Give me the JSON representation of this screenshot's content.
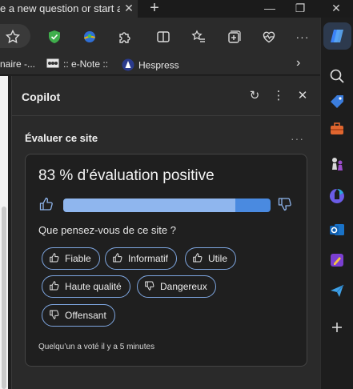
{
  "browser": {
    "tab_title": "e a new question or start a c",
    "tab_close": "✕",
    "new_tab": "+",
    "window_minimize": "—",
    "window_restore": "❐",
    "window_close": "✕"
  },
  "toolbar": {
    "icons": [
      "favorite-star-icon",
      "adguard-shield-icon",
      "extension-globe-icon",
      "extensions-puzzle-icon",
      "split-screen-icon",
      "favorites-list-icon",
      "collections-icon",
      "browser-essentials-heart-icon",
      "more-dots-icon",
      "copilot-icon"
    ],
    "more_label": "···"
  },
  "bookmarks": {
    "items": [
      {
        "label": "naire -..."
      },
      {
        "label": ":: e-Note ::"
      },
      {
        "label": "Hespress"
      }
    ],
    "overflow": "›"
  },
  "copilot": {
    "title": "Copilot",
    "refresh": "↻",
    "more": "⋮",
    "close": "✕",
    "section_title": "Évaluer ce site",
    "section_more": "···",
    "rating": {
      "headline": "83 % d’évaluation positive",
      "positive_fraction": 0.83,
      "question": "Que pensez-vous de ce site ?",
      "chips": [
        {
          "label": "Fiable",
          "kind": "up"
        },
        {
          "label": "Informatif",
          "kind": "up"
        },
        {
          "label": "Utile",
          "kind": "up"
        },
        {
          "label": "Haute qualité",
          "kind": "up"
        },
        {
          "label": "Dangereux",
          "kind": "down"
        },
        {
          "label": "Offensant",
          "kind": "down"
        }
      ],
      "voted": "Quelqu’un a voté il y a 5 minutes"
    }
  },
  "sidebar": {
    "icons": [
      "search-icon",
      "tag-icon",
      "toolbox-icon",
      "chess-icon",
      "m365-icon",
      "outlook-icon",
      "designer-icon",
      "send-icon",
      "add-icon"
    ]
  },
  "colors": {
    "bar_positive": "#8fb6ee",
    "bar_negative": "#4a8ae0",
    "chip_border": "#7ea6e0",
    "copilot_accent": "#3b82f6"
  }
}
